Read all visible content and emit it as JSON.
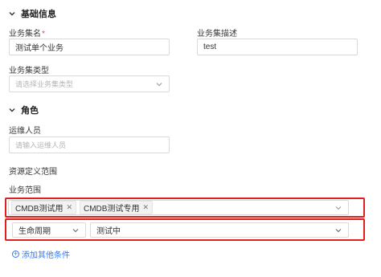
{
  "basic_info": {
    "title": "基础信息",
    "set_name_label": "业务集名",
    "set_name_value": "测试单个业务",
    "set_desc_label": "业务集描述",
    "set_desc_value": "test",
    "set_type_label": "业务集类型",
    "set_type_placeholder": "请选择业务集类型"
  },
  "role": {
    "title": "角色",
    "ops_label": "运维人员",
    "ops_placeholder": "请输入运维人员"
  },
  "resource_scope": {
    "title": "资源定义范围",
    "business_scope_label": "业务范围",
    "tags": [
      "CMDB测试用",
      "CMDB测试专用"
    ],
    "condition_field": "生命周期",
    "condition_value": "测试中",
    "add_condition_label": "添加其他条件"
  },
  "colors": {
    "accent": "#2f7cf6",
    "highlight": "#e02020",
    "required": "#e5484d"
  }
}
